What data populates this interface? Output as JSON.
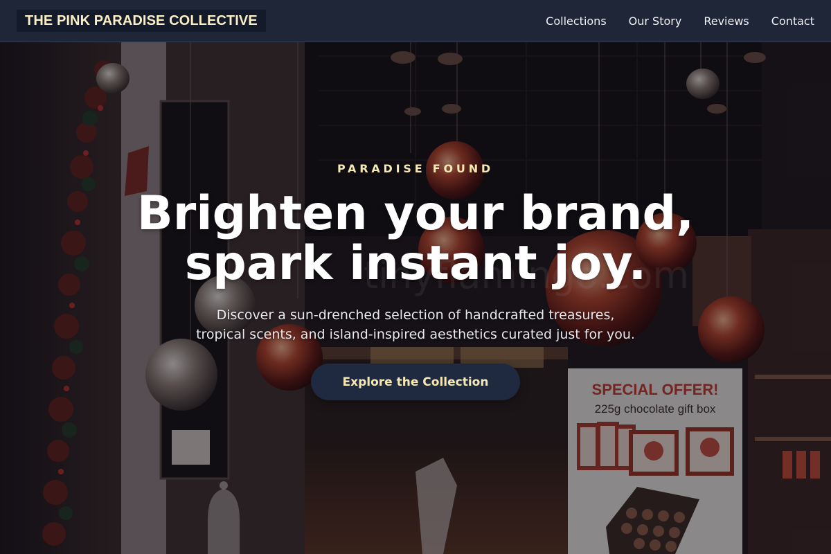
{
  "header": {
    "brand": "THE PINK PARADISE COLLECTIVE",
    "nav": [
      "Collections",
      "Our Story",
      "Reviews",
      "Contact"
    ]
  },
  "hero": {
    "eyebrow": "PARADISE FOUND",
    "headline_line1": "Brighten your brand,",
    "headline_line2": "spark instant joy.",
    "subtext_line1": "Discover a sun-drenched selection of handcrafted treasures,",
    "subtext_line2": "tropical scents, and island-inspired aesthetics curated just for you.",
    "cta_label": "Explore the Collection"
  },
  "background_photo": {
    "sign_title": "SPECIAL OFFER!",
    "sign_subtitle": "225g chocolate gift box",
    "watermark": "tinyflamingo.com"
  },
  "colors": {
    "header_bg": "#1e2638",
    "brand_bg": "#131a2a",
    "accent_cream": "#f6e8b4",
    "cta_bg": "#1f2a40",
    "sign_red": "#c0392b"
  }
}
